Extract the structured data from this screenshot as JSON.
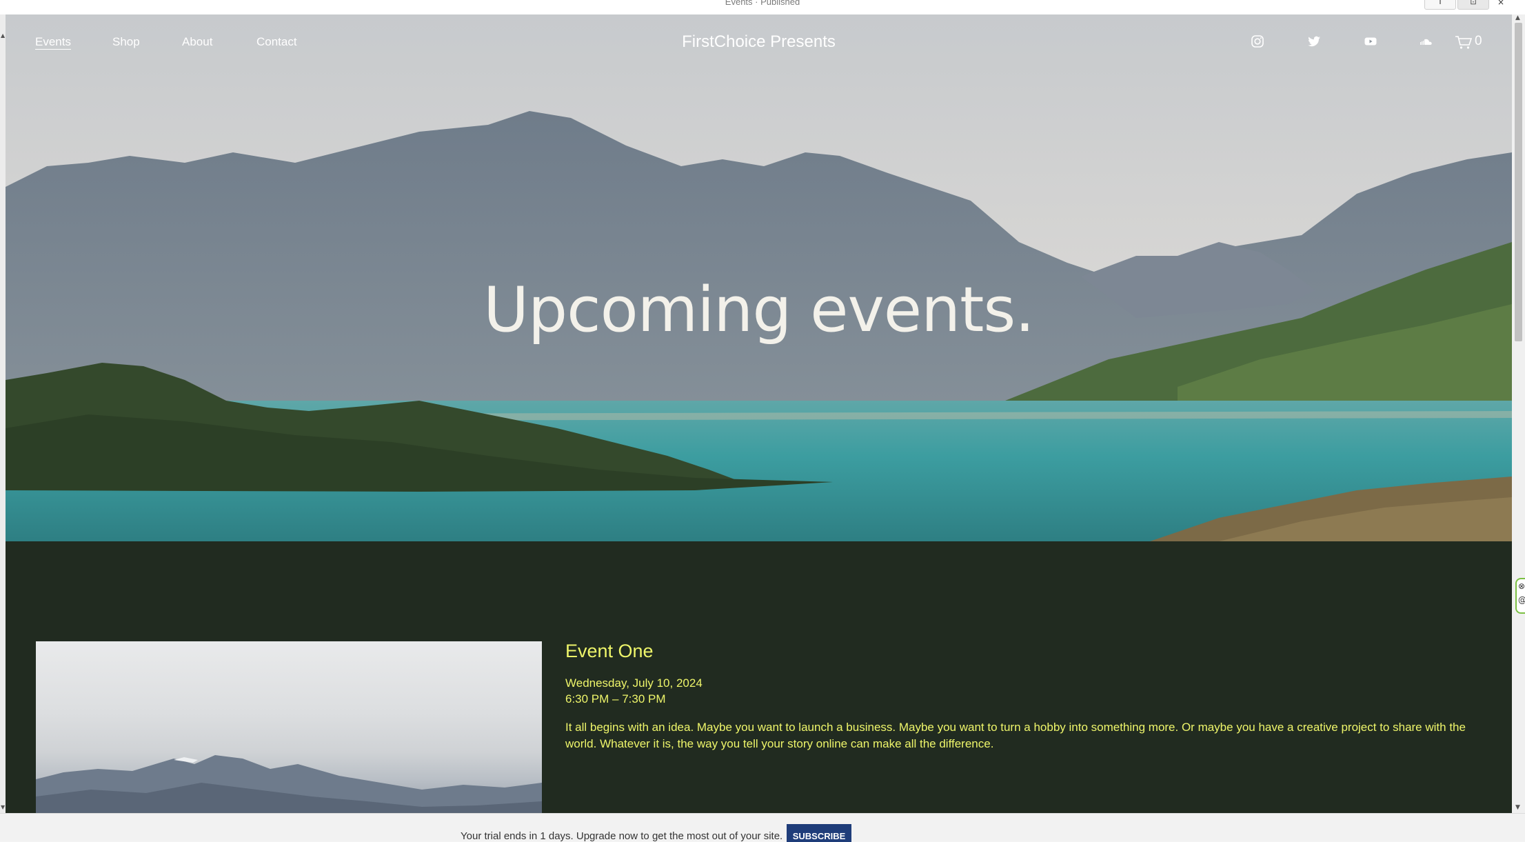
{
  "editor": {
    "status": "Events · Published",
    "tool_1_glyph": "I",
    "tool_2_glyph": "⊡",
    "close_glyph": "×"
  },
  "site": {
    "brand": "FirstChoice Presents",
    "nav": [
      "Events",
      "Shop",
      "About",
      "Contact"
    ],
    "active_nav": "Events",
    "social_icons": [
      "instagram-icon",
      "twitter-icon",
      "youtube-icon",
      "soundcloud-icon"
    ],
    "cart_icon": "cart-icon",
    "cart_count": "0"
  },
  "hero": {
    "title": "Upcoming events."
  },
  "events": [
    {
      "title": "Event One",
      "date": "Wednesday, July 10, 2024",
      "time": "6:30 PM – 7:30 PM",
      "description": "It all begins with an idea. Maybe you want to launch a business. Maybe you want to turn a hobby into something more. Or maybe you have a creative project to share with the world. Whatever it is, the way you tell your story online can make all the difference."
    }
  ],
  "trial_banner": {
    "text": "Your trial ends in 1 days. Upgrade now to get the most out of your site.",
    "button": "SUBSCRIBE"
  },
  "colors": {
    "event_section_bg": "#212b20",
    "event_text": "#eef56a",
    "subscribe_bg": "#1f3d7a"
  }
}
